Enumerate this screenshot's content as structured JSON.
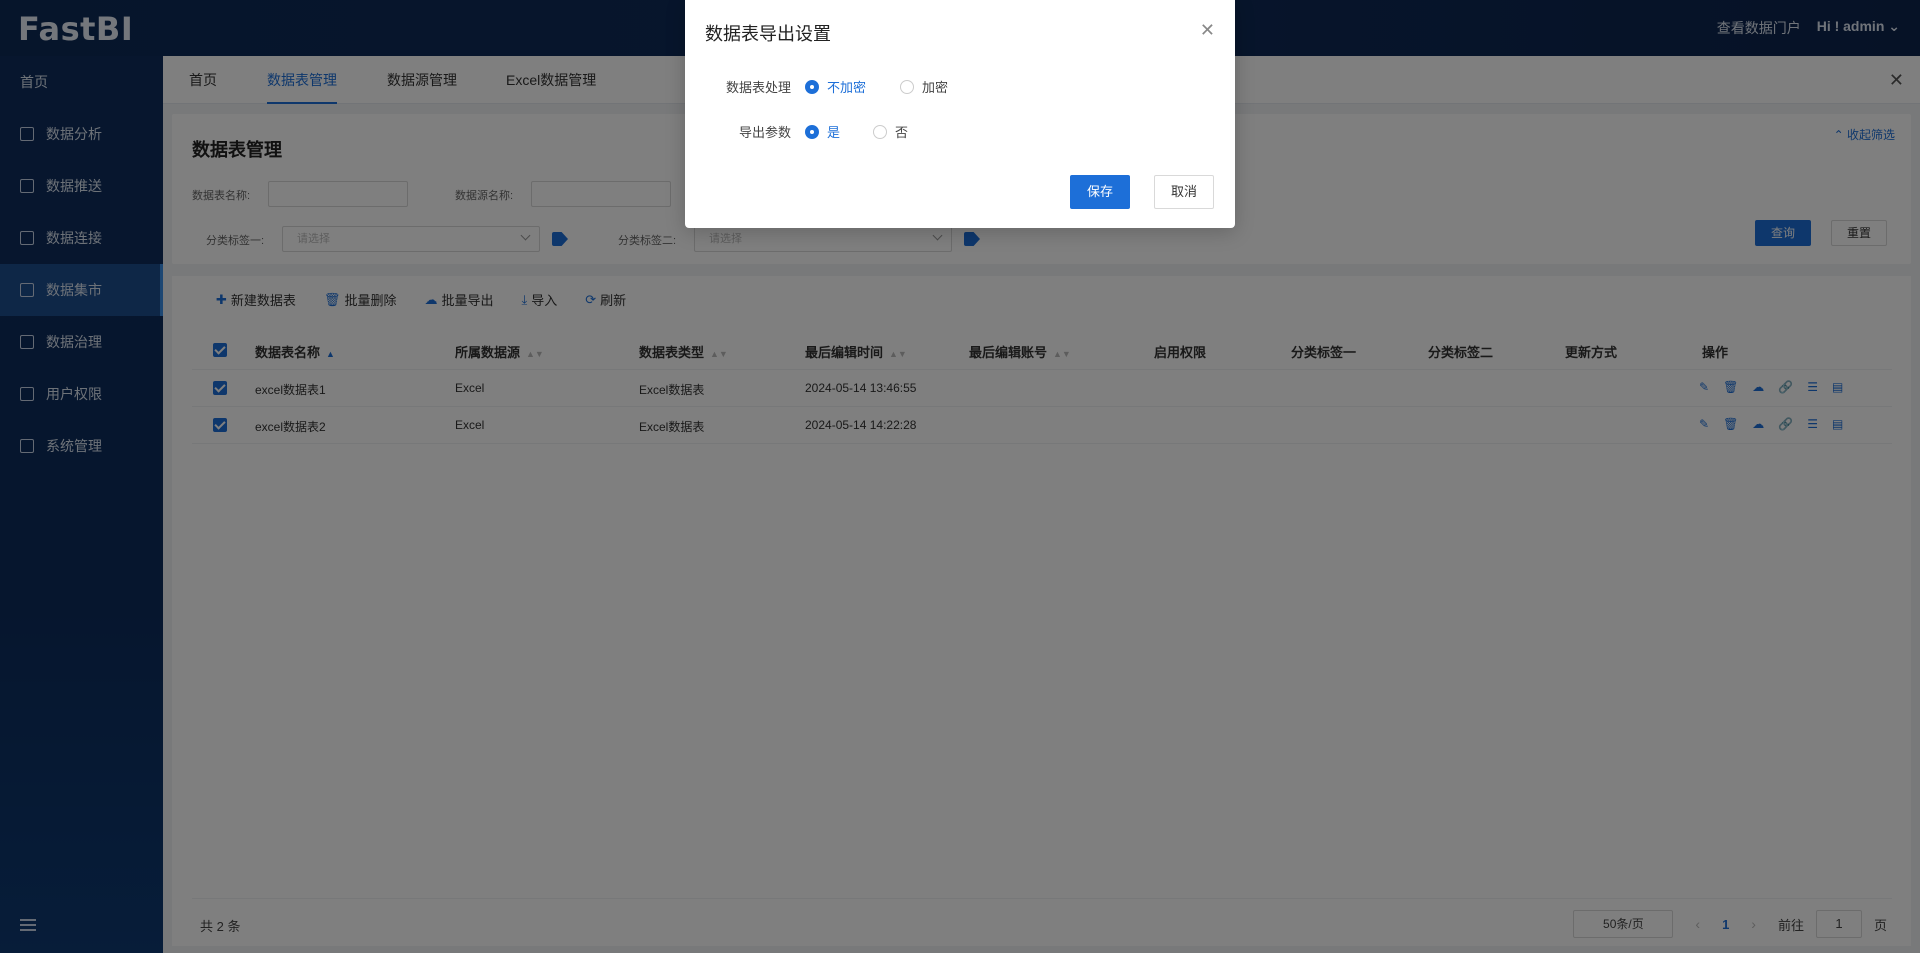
{
  "app": {
    "logo": "FastBI",
    "portal_link": "查看数据门户",
    "user": "Hi ! admin"
  },
  "sidebar": {
    "items": [
      {
        "label": "首页"
      },
      {
        "label": "数据分析"
      },
      {
        "label": "数据推送"
      },
      {
        "label": "数据连接"
      },
      {
        "label": "数据集市"
      },
      {
        "label": "数据治理"
      },
      {
        "label": "用户权限"
      },
      {
        "label": "系统管理"
      }
    ],
    "active_index": 4
  },
  "tabs": [
    "首页",
    "数据表管理",
    "数据源管理",
    "Excel数据管理"
  ],
  "filter": {
    "title": "数据表管理",
    "collapse_label": "收起筛选",
    "table_name_label": "数据表名称:",
    "source_name_label": "数据源名称:",
    "tag1_label": "分类标签一:",
    "tag2_label": "分类标签二:",
    "select_placeholder": "请选择",
    "query_label": "查询",
    "reset_label": "重置"
  },
  "toolbar": {
    "new": "新建数据表",
    "batch_delete": "批量删除",
    "batch_export": "批量导出",
    "import": "导入",
    "refresh": "刷新"
  },
  "table": {
    "headers": [
      "数据表名称",
      "所属数据源",
      "数据表类型",
      "最后编辑时间",
      "最后编辑账号",
      "启用权限",
      "分类标签一",
      "分类标签二",
      "更新方式",
      "操作"
    ],
    "rows": [
      {
        "name": "excel数据表1",
        "source": "Excel",
        "type": "Excel数据表",
        "edit_time": "2024-05-14 13:46:55"
      },
      {
        "name": "excel数据表2",
        "source": "Excel",
        "type": "Excel数据表",
        "edit_time": "2024-05-14 14:22:28"
      }
    ]
  },
  "footer": {
    "total": "共 2 条",
    "page_size": "50条/页",
    "current_page": "1",
    "goto_label": "前往",
    "goto_value": "1",
    "page_unit": "页"
  },
  "modal": {
    "title": "数据表导出设置",
    "row1_label": "数据表处理",
    "row1_opt1": "不加密",
    "row1_opt2": "加密",
    "row2_label": "导出参数",
    "row2_opt1": "是",
    "row2_opt2": "否",
    "save": "保存",
    "cancel": "取消"
  },
  "colors": {
    "accent": "#1d6fd8",
    "topbar": "#0f2c5a",
    "sidebar": "#0c2c5c"
  }
}
